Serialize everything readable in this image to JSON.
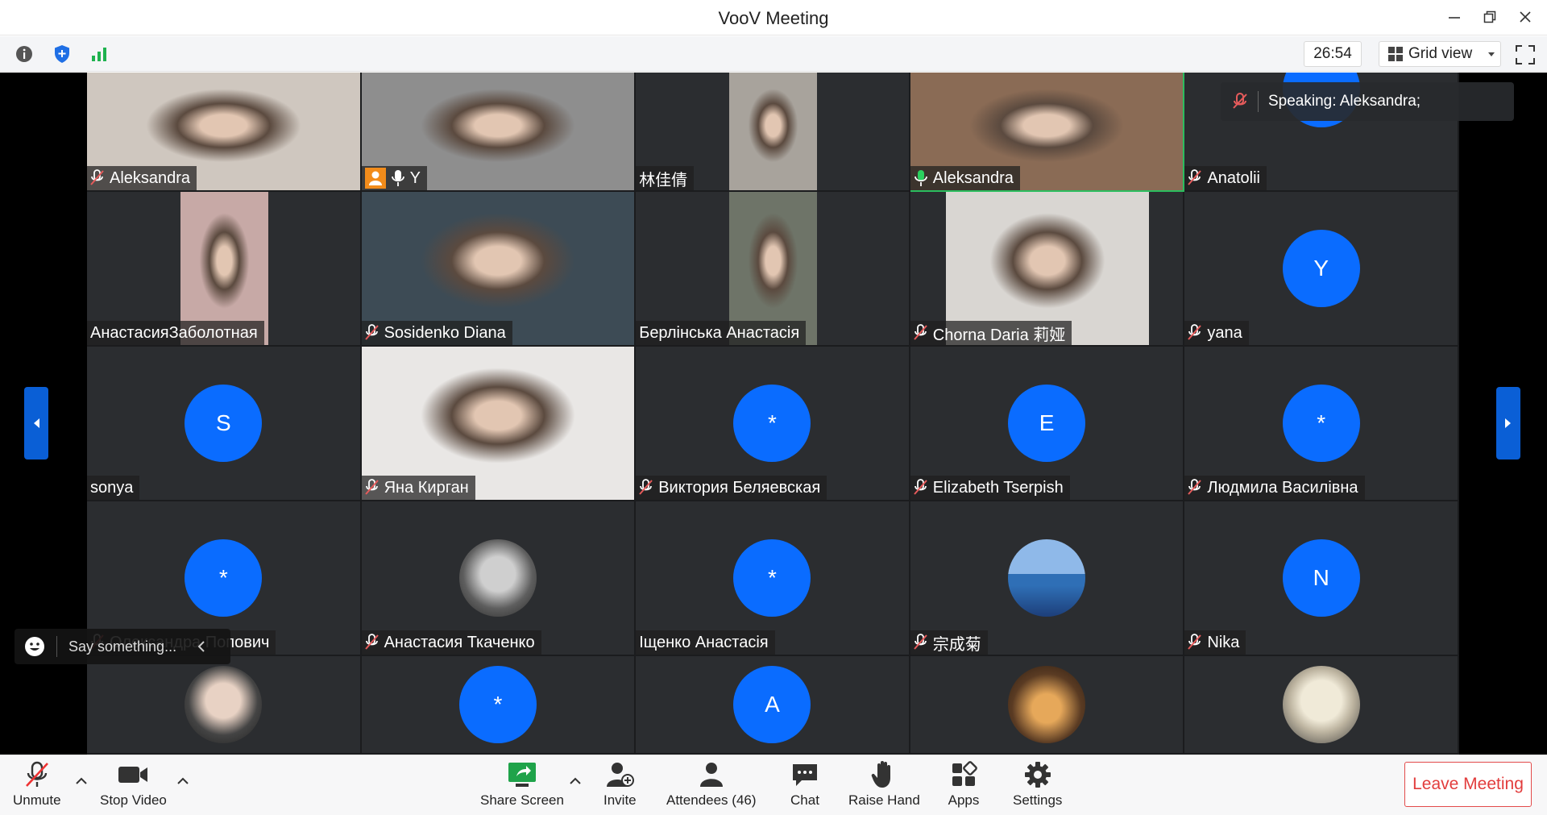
{
  "window": {
    "title": "VooV Meeting"
  },
  "toolbar_top": {
    "timer": "26:54",
    "view_label": "Grid view"
  },
  "speaking": {
    "label": "Speaking: Aleksandra;"
  },
  "chat": {
    "placeholder": "Say something..."
  },
  "tiles": [
    {
      "name": "Aleksandra",
      "mic": "off",
      "kind": "video",
      "video_color": "#cfc7bf"
    },
    {
      "name": "Y",
      "mic": "on",
      "kind": "video",
      "video_color": "#8e8e8e"
    },
    {
      "name": "林佳倩",
      "mic": "none",
      "kind": "video",
      "video_color": "#a8a39c"
    },
    {
      "name": "Aleksandra",
      "mic": "active",
      "kind": "video",
      "video_color": "#8a6b55"
    },
    {
      "name": "Anatolii",
      "mic": "off",
      "kind": "avatar",
      "avatar_text": ""
    },
    {
      "name": "АнастасияЗаболотная",
      "mic": "none",
      "kind": "video",
      "video_color": "#c7a9a6"
    },
    {
      "name": "Sosidenko Diana",
      "mic": "off",
      "kind": "video",
      "video_color": "#3d4b55"
    },
    {
      "name": "Берлінська Анастасія",
      "mic": "none",
      "kind": "video",
      "video_color": "#6e7468"
    },
    {
      "name": "Chorna Daria 莉娅",
      "mic": "off",
      "kind": "video",
      "video_color": "#d9d6d2"
    },
    {
      "name": "yana",
      "mic": "off",
      "kind": "avatar",
      "avatar_text": "Y"
    },
    {
      "name": "sonya",
      "mic": "none",
      "kind": "avatar",
      "avatar_text": "S"
    },
    {
      "name": "Яна Кирган",
      "mic": "off",
      "kind": "video",
      "video_color": "#e9e7e5"
    },
    {
      "name": "Виктория Беляевская",
      "mic": "off",
      "kind": "avatar",
      "avatar_text": "*"
    },
    {
      "name": "Elizabeth Tserpish",
      "mic": "off",
      "kind": "avatar",
      "avatar_text": "E"
    },
    {
      "name": "Людмила Василівна",
      "mic": "off",
      "kind": "avatar",
      "avatar_text": "*"
    },
    {
      "name": "Олександра Попович",
      "mic": "off",
      "kind": "avatar",
      "avatar_text": "*"
    },
    {
      "name": "Анастасия Ткаченко",
      "mic": "off",
      "kind": "photo",
      "photo": "guitar"
    },
    {
      "name": "Іщенко Анастасія",
      "mic": "none",
      "kind": "avatar",
      "avatar_text": "*"
    },
    {
      "name": "宗成菊",
      "mic": "off",
      "kind": "photo",
      "photo": "sea"
    },
    {
      "name": "Nika",
      "mic": "off",
      "kind": "avatar",
      "avatar_text": "N"
    },
    {
      "name": "",
      "mic": "none",
      "kind": "photo",
      "photo": "girl"
    },
    {
      "name": "",
      "mic": "none",
      "kind": "avatar",
      "avatar_text": "*"
    },
    {
      "name": "",
      "mic": "none",
      "kind": "avatar",
      "avatar_text": "A"
    },
    {
      "name": "",
      "mic": "none",
      "kind": "photo",
      "photo": "cafe"
    },
    {
      "name": "",
      "mic": "none",
      "kind": "photo",
      "photo": "blonde"
    }
  ],
  "bottom_bar": {
    "unmute": "Unmute",
    "stop_video": "Stop Video",
    "share_screen": "Share Screen",
    "invite": "Invite",
    "attendees": "Attendees (46)",
    "chat": "Chat",
    "raise_hand": "Raise Hand",
    "apps": "Apps",
    "settings": "Settings",
    "leave": "Leave Meeting"
  },
  "colors": {
    "accent": "#0a6cff",
    "leave": "#e23c3c",
    "speaking": "#2bbd5e"
  }
}
